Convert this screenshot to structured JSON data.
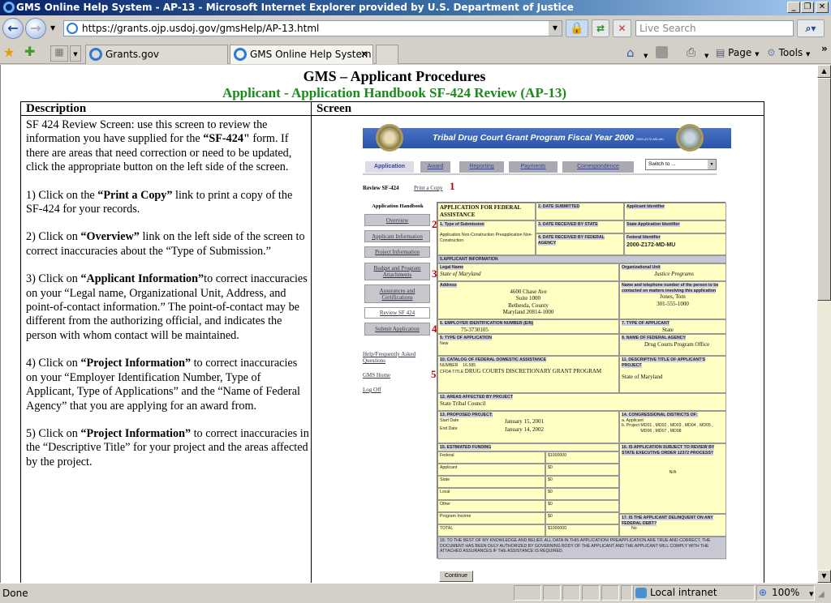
{
  "window": {
    "title": "GMS Online Help System - AP-13 - Microsoft Internet Explorer provided by U.S. Department of Justice",
    "minimize": "_",
    "restore": "❐",
    "close": "✕"
  },
  "nav": {
    "back": "←",
    "forward": "→",
    "url": "https://grants.ojp.usdoj.gov/gmsHelp/AP-13.html",
    "search_placeholder": "Live Search"
  },
  "tabs": [
    {
      "label": "Grants.gov"
    },
    {
      "label": "GMS Online Help System ...",
      "close": "✕"
    }
  ],
  "commands": {
    "page": "Page",
    "tools": "Tools",
    "more": "»"
  },
  "page": {
    "title": "GMS – Applicant Procedures",
    "subtitle": "Applicant - Application Handbook SF-424 Review (AP-13)",
    "col_description": "Description",
    "col_screen": "Screen",
    "paragraphs": [
      [
        "SF 424 Review Screen: use this screen to review the information you have supplied for the ",
        "“SF-424\"",
        " form.   If there are areas that need correction or need to be updated, click the appropriate button on the left side of the screen."
      ],
      [
        "1) Click on the ",
        "“Print a Copy”",
        " link to print a copy of the SF-424 for your records."
      ],
      [
        "2) Click on ",
        "“Overview”",
        " link on the left side of the screen to correct inaccuracies about the “Type of Submission.”"
      ],
      [
        "3) Click on ",
        "“Applicant Information”",
        "to correct inaccuracies on your “Legal name, Organizational Unit, Address, and point-of-contact information.”  The point-of-contact may be different from the authorizing official, and indicates the person with whom contact will be maintained."
      ],
      [
        "4) Click on ",
        "“Project Information”",
        " to correct inaccuracies on your “Employer Identification Number, Type of Applicant, Type of Applications” and the “Name of Federal Agency” that you are applying for an award from."
      ],
      [
        "5) Click on ",
        "“Project Information”",
        " to correct inaccuracies in the “Descriptive Title” for your project and the areas affected by the project."
      ]
    ]
  },
  "screen": {
    "banner": "Tribal Drug Court Grant Program Fiscal Year 2000",
    "banner_code": "2000-Z172-MD-MU",
    "app_tabs": [
      "Application",
      "Award",
      "Reporting",
      "Payments",
      "Correspondence"
    ],
    "switch_to": "Switch to ...",
    "review_label": "Review SF-424",
    "print_link": "Print a Copy",
    "sidebar_title": "Application Handbook",
    "sidebar_buttons": [
      "Overview",
      "Applicant Information",
      "Project Information",
      "Budget and Program Attachments",
      "Assurances and Certifications",
      "Review SF 424",
      "Submit Application"
    ],
    "sidebar_links": [
      "Help/Frequently Asked Questions",
      "GMS Home",
      "Log Off"
    ],
    "markers": [
      "1",
      "2",
      "3",
      "4",
      "5"
    ],
    "form": {
      "title": "APPLICATION FOR FEDERAL ASSISTANCE",
      "date_submitted": "2. DATE SUBMITTED",
      "applicant_identifier": "Applicant Identifier",
      "type_submission": "1. Type of Submission",
      "type_submission_value": "Application Non-Construction Preapplication Non-Construction",
      "date_state": "3. DATE RECEIVED BY STATE",
      "state_app_id": "State Application Identifier",
      "date_federal": "4. DATE RECEIVED BY FEDERAL AGENCY",
      "federal_id": "Federal Identifier",
      "federal_id_value": "2000-Z172-MD-MU",
      "applicant_info": "5.APPLICANT INFORMATION",
      "legal_name": "Legal Name",
      "legal_name_value": "State of Maryland",
      "org_unit": "Organizational Unit",
      "org_unit_value": "Justice Programs",
      "address": "Address",
      "address_lines": [
        "4600 Chase Ave",
        "Suite 1000",
        "Bethesda, County",
        "Maryland 20814-1000"
      ],
      "contact": "Name and telephone number of the person to be contacted on matters involving this application",
      "contact_name": "Jones, Tom",
      "contact_phone": "301-555-1000",
      "ein": "6. EMPLOYER IDENTIFICATION NUMBER (EIN)",
      "ein_value": "75-3730105",
      "type_applicant": "7. TYPE OF APPLICANT",
      "type_applicant_value": "State",
      "type_application": "9. TYPE OF APPLICATION",
      "type_application_value": "New",
      "agency": "8. NAME OF FEDERAL AGENCY",
      "agency_value": "Drug Courts Program Office",
      "catalog": "10. CATALOG OF FEDERAL DOMESTIC ASSISTANCE",
      "number_label": "NUMBER",
      "number_value": "16.585",
      "cfda_label": "CFDA TITLE",
      "cfda_value": "DRUG COURTS DISCRETIONARY GRANT PROGRAM",
      "desc_title": "11. DESCRIPTIVE TITLE OF APPLICANT'S PROJECT",
      "desc_title_value": "State of Maryland",
      "areas": "12. AREAS AFFECTED BY PROJECT",
      "areas_value": "State Tribal Council",
      "proposed": "13. PROPOSED PROJECT:",
      "start_label": "Start Date",
      "start_value": "January 15, 2001",
      "end_label": "End Date",
      "end_value": "January 14, 2002",
      "districts": "14. CONGRESSIONAL DISTRICTS OF:",
      "dist_applicant": "a. Applicant",
      "dist_project": "b. Project",
      "dist_project_value": "MD01 , MD02 , MD03 , MD04 , MD05 , MD06 , MD07 , MD08",
      "funding": "15. ESTIMATED FUNDING",
      "funding_rows": [
        {
          "label": "Federal",
          "value": "$1000000"
        },
        {
          "label": "Applicant",
          "value": "$0"
        },
        {
          "label": "State",
          "value": "$0"
        },
        {
          "label": "Local",
          "value": "$0"
        },
        {
          "label": "Other",
          "value": "$0"
        },
        {
          "label": "Program Income",
          "value": "$0"
        },
        {
          "label": "TOTAL",
          "value": "$1000000"
        }
      ],
      "review": "16. IS APPLICATION SUBJECT TO REVIEW BY STATE EXECUTIVE ORDER 12372 PROCESS?",
      "review_value": "N/A",
      "delinquent": "17. IS THE APPLICANT DELINQUENT ON ANY FEDERAL DEBT?",
      "delinquent_value": "No",
      "certify": "18. TO THE BEST OF MY KNOWLEDGE AND BELIEF, ALL DATA IN THIS APPLICATION/ PREAPPLICATION ARE TRUE AND CORRECT, THE DOCUMENT HAS BEEN DULY AUTHORIZED BY GOVERNING BODY OF THE APPLICANT AND THE APPLICANT WILL COMPLY WITH THE ATTACHED ASSURANCES IF THE ASSISTANCE IS REQUIRED."
    },
    "continue": "Continue"
  },
  "status": {
    "text": "Done",
    "zone": "Local intranet",
    "zoom": "100%"
  }
}
